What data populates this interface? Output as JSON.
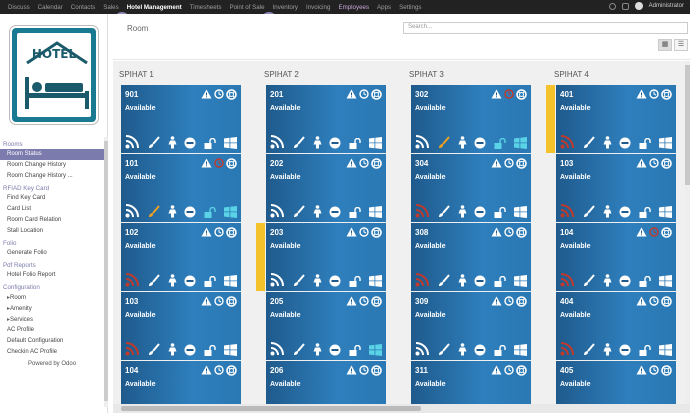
{
  "topmenu": {
    "items": [
      "Discuss",
      "Calendar",
      "Contacts",
      "Sales",
      "Hotel Management",
      "Timesheets",
      "Point of Sale",
      "Inventory",
      "Invoicing",
      "Employees",
      "Apps",
      "Settings"
    ],
    "active_index": 4,
    "user": "Administrator"
  },
  "logo": {
    "text": "HOTEL"
  },
  "sidebar": {
    "sections": [
      {
        "title": "Rooms",
        "items": [
          {
            "label": "Room Status",
            "active": true
          },
          {
            "label": "Room Change History"
          },
          {
            "label": "Room Change History ..."
          }
        ]
      },
      {
        "title": "RFIAD Key Card",
        "items": [
          {
            "label": "Find Key Card"
          },
          {
            "label": "Card List"
          },
          {
            "label": "Room Card Relation"
          },
          {
            "label": "Stall Location"
          }
        ]
      },
      {
        "title": "Folio",
        "items": [
          {
            "label": "Generate Folio"
          }
        ]
      },
      {
        "title": "Pdf Reports",
        "items": [
          {
            "label": "Hotel Folio Report"
          }
        ]
      },
      {
        "title": "Configuration",
        "items": [
          {
            "label": "Room",
            "caret": true
          },
          {
            "label": "Amenity",
            "caret": true
          },
          {
            "label": "Services",
            "caret": true
          },
          {
            "label": "AC Profile"
          },
          {
            "label": "Default Configuration"
          },
          {
            "label": "Checkin AC Profile"
          }
        ]
      }
    ],
    "powered": "Powered by Odoo"
  },
  "main": {
    "breadcrumb": "Room",
    "search_placeholder": "Search..."
  },
  "board": {
    "columns": [
      {
        "title": "SPIHAT 1",
        "cards": [
          {
            "num": "901",
            "status": "Available",
            "flag": false,
            "variant": "a"
          },
          {
            "num": "101",
            "status": "Available",
            "flag": false,
            "variant": "b"
          },
          {
            "num": "102",
            "status": "Available",
            "flag": false,
            "variant": "c"
          },
          {
            "num": "103",
            "status": "Available",
            "flag": false,
            "variant": "c"
          },
          {
            "num": "104",
            "status": "Available",
            "flag": false,
            "variant": "a"
          }
        ]
      },
      {
        "title": "SPIHAT 2",
        "cards": [
          {
            "num": "201",
            "status": "Available",
            "flag": false,
            "variant": "a"
          },
          {
            "num": "202",
            "status": "Available",
            "flag": false,
            "variant": "a"
          },
          {
            "num": "203",
            "status": "Available",
            "flag": true,
            "variant": "a"
          },
          {
            "num": "205",
            "status": "Available",
            "flag": false,
            "variant": "d"
          },
          {
            "num": "206",
            "status": "Available",
            "flag": false,
            "variant": "a"
          }
        ]
      },
      {
        "title": "SPIHAT 3",
        "cards": [
          {
            "num": "302",
            "status": "Available",
            "flag": false,
            "variant": "b"
          },
          {
            "num": "304",
            "status": "Available",
            "flag": false,
            "variant": "c"
          },
          {
            "num": "308",
            "status": "Available",
            "flag": false,
            "variant": "c"
          },
          {
            "num": "309",
            "status": "Available",
            "flag": false,
            "variant": "a"
          },
          {
            "num": "311",
            "status": "Available",
            "flag": false,
            "variant": "a"
          }
        ]
      },
      {
        "title": "SPIHAT 4",
        "cards": [
          {
            "num": "401",
            "status": "Available",
            "flag": true,
            "variant": "c"
          },
          {
            "num": "103",
            "status": "Available",
            "flag": false,
            "variant": "c"
          },
          {
            "num": "104",
            "status": "Available",
            "flag": false,
            "variant": "e"
          },
          {
            "num": "404",
            "status": "Available",
            "flag": false,
            "variant": "c"
          },
          {
            "num": "405",
            "status": "Available",
            "flag": false,
            "variant": "a"
          }
        ]
      }
    ]
  },
  "colors": {
    "topbar": "#222222",
    "accent": "#7c7bad",
    "card": "#2a78b3",
    "flag": "#f4c22b",
    "wifi_off": "#c0392b",
    "cyan": "#5bd3e6",
    "orange": "#f0a020"
  }
}
